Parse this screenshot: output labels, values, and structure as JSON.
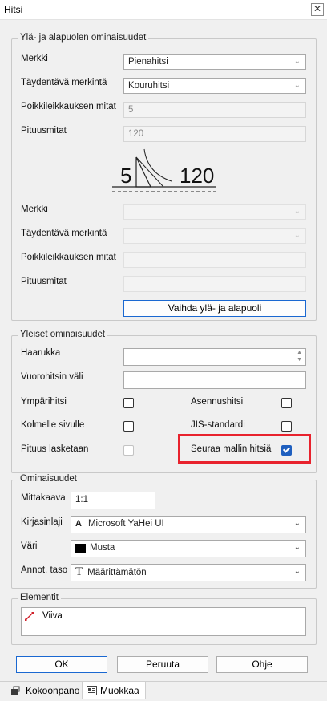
{
  "window": {
    "title": "Hitsi",
    "close_glyph": "✕"
  },
  "group_top": {
    "label": "Ylä- ja alapuolen ominaisuudet",
    "upper": {
      "merkki_label": "Merkki",
      "merkki_value": "Pienahitsi",
      "taydentava_label": "Täydentävä merkintä",
      "taydentava_value": "Kouruhitsi",
      "poikki_label": "Poikkileikkauksen mitat",
      "poikki_value": "5",
      "pituus_label": "Pituusmitat",
      "pituus_value": "120"
    },
    "symbol": {
      "left_text": "5",
      "right_text": "120"
    },
    "lower": {
      "merkki_label": "Merkki",
      "merkki_value": "",
      "taydentava_label": "Täydentävä merkintä",
      "taydentava_value": "",
      "poikki_label": "Poikkileikkauksen mitat",
      "poikki_value": "",
      "pituus_label": "Pituusmitat",
      "pituus_value": ""
    },
    "swap_button": "Vaihda ylä- ja alapuoli"
  },
  "group_general": {
    "label": "Yleiset ominaisuudet",
    "haarukka_label": "Haarukka",
    "haarukka_value": "",
    "vuoro_label": "Vuorohitsin väli",
    "vuoro_value": "",
    "ymparihitsi_label": "Ympärihitsi",
    "ymparihitsi_checked": false,
    "asennushitsi_label": "Asennushitsi",
    "asennushitsi_checked": false,
    "kolmelle_label": "Kolmelle sivulle",
    "kolmelle_checked": false,
    "jis_label": "JIS-standardi",
    "jis_checked": false,
    "pituus_lasketaan_label": "Pituus lasketaan",
    "pituus_lasketaan_checked": false,
    "seuraa_label": "Seuraa mallin hitsiä",
    "seuraa_checked": true
  },
  "group_props": {
    "label": "Ominaisuudet",
    "mittakaava_label": "Mittakaava",
    "mittakaava_value": "1:1",
    "kirjasin_label": "Kirjasinlaji",
    "kirjasin_value": "Microsoft YaHei UI",
    "kirjasin_icon": "A",
    "vari_label": "Väri",
    "vari_value": "Musta",
    "vari_swatch": "#000000",
    "annot_label": "Annot. taso",
    "annot_value": "Määrittämätön",
    "annot_icon": "T"
  },
  "group_elements": {
    "label": "Elementit",
    "items": [
      {
        "label": "Viiva",
        "icon": "line-icon",
        "icon_color": "#d0202a"
      }
    ]
  },
  "buttons": {
    "ok": "OK",
    "cancel": "Peruuta",
    "help": "Ohje"
  },
  "tabs": [
    {
      "label": "Kokoonpano",
      "icon": "assembly-icon",
      "active": false
    },
    {
      "label": "Muokkaa",
      "icon": "edit-icon",
      "active": true
    }
  ],
  "colors": {
    "accent": "#1a68d1",
    "highlight": "#e8222d"
  }
}
